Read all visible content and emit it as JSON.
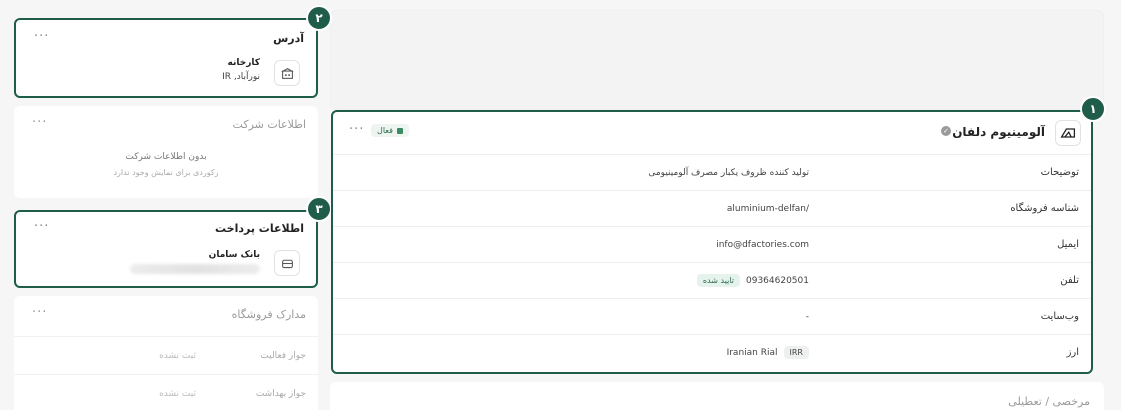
{
  "address_card": {
    "title": "آدرس",
    "badge": "۲",
    "item_name": "کارخانه",
    "item_location": "نورآباد, IR"
  },
  "company_card": {
    "title": "اطلاعات شرکت",
    "empty_title": "بدون اطلاعات شرکت",
    "empty_subtitle": "رکوردی برای نمایش وجود ندارد"
  },
  "payment_card": {
    "title": "اطلاعات پرداخت",
    "badge": "۳",
    "bank_name": "بانک سامان"
  },
  "documents_card": {
    "title": "مدارک فروشگاه",
    "rows": [
      {
        "label": "جواز فعالیت",
        "value": "ثبت نشده"
      },
      {
        "label": "جواز بهداشت",
        "value": "ثبت نشده"
      }
    ]
  },
  "store_card": {
    "badge": "۱",
    "name": "آلومینیوم دلفان",
    "status": "فعال",
    "rows": [
      {
        "label": "توضیحات",
        "value": "تولید کننده ظروف یکبار مصرف آلومینیومی"
      },
      {
        "label": "شناسه فروشگاه",
        "value": "aluminium-delfan/"
      },
      {
        "label": "ایمیل",
        "value": "info@dfactories.com"
      },
      {
        "label": "تلفن",
        "value": "09364620501",
        "tag": "تایید شده"
      },
      {
        "label": "وب‌سایت",
        "value": "-"
      },
      {
        "label": "ارز",
        "value": "Iranian Rial",
        "tag": "IRR"
      }
    ]
  },
  "holiday_card": {
    "title": "مرخصی / تعطیلی"
  },
  "colors": {
    "highlight": "#1f5c4a",
    "status_green": "#3d8a64"
  }
}
